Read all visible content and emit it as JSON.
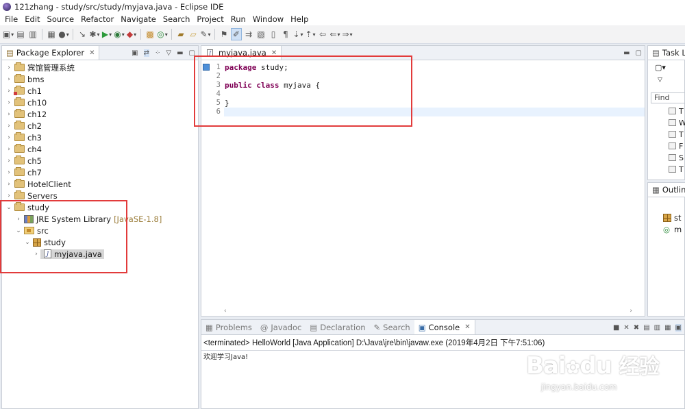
{
  "window": {
    "title": "121zhang - study/src/study/myjava.java - Eclipse IDE"
  },
  "menu": [
    "File",
    "Edit",
    "Source",
    "Refactor",
    "Navigate",
    "Search",
    "Project",
    "Run",
    "Window",
    "Help"
  ],
  "explorer": {
    "tab": "Package Explorer",
    "projects": [
      "宾馆管理系统",
      "bms",
      "ch1",
      "ch10",
      "ch12",
      "ch2",
      "ch3",
      "ch4",
      "ch5",
      "ch7",
      "HotelClient",
      "Servers"
    ],
    "open_project": "study",
    "jre": {
      "label": "JRE System Library",
      "suffix": "[JavaSE-1.8]"
    },
    "src": "src",
    "package": "study",
    "file": "myjava.java"
  },
  "editor": {
    "tab": "myjava.java",
    "line_numbers": [
      "1",
      "2",
      "3",
      "4",
      "5",
      "6"
    ],
    "line1": {
      "kw": "package",
      "rest": " study;"
    },
    "line3": {
      "kw1": "public",
      "kw2": "class",
      "rest": " myjava {"
    },
    "line5": "}"
  },
  "task_list": {
    "tab": "Task Li",
    "find_placeholder": "Find",
    "rows": [
      "T",
      "W",
      "T",
      "F",
      "S",
      "T"
    ]
  },
  "outline": {
    "tab": "Outline",
    "rows": [
      "st",
      "m"
    ]
  },
  "bottom": {
    "tabs": [
      "Problems",
      "Javadoc",
      "Declaration",
      "Search",
      "Console"
    ],
    "status": "<terminated> HelloWorld [Java Application] D:\\Java\\jre\\bin\\javaw.exe (2019年4月2日 下午7:51:06)",
    "output": "欢迎学习Java!"
  },
  "watermark": {
    "brand": "Bai",
    "brand2": "du",
    "cn": "经验",
    "url": "jingyan.baidu.com"
  },
  "colors": {
    "annotation": "#e23b3b",
    "keyword": "#7f0055",
    "current_line": "#e8f2fe"
  }
}
